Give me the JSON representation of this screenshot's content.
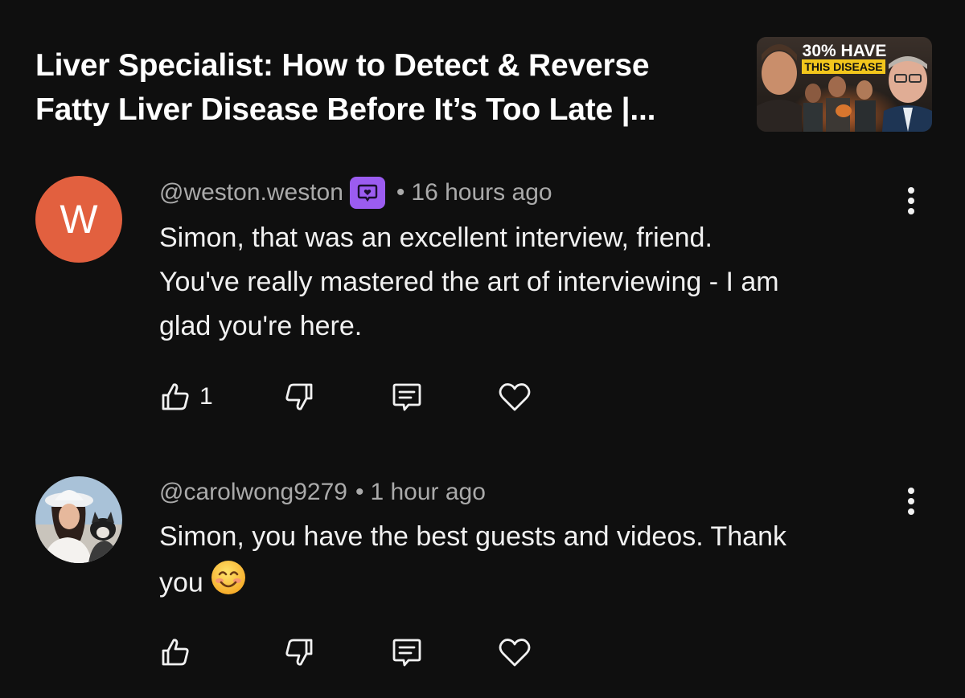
{
  "video": {
    "title_line1": "Liver Specialist: How to Detect & Reverse",
    "title_line2": "Fatty Liver Disease Before It’s Too Late |...",
    "thumbnail": {
      "text_line1": "30% HAVE",
      "text_line2": "THIS DISEASE"
    }
  },
  "comments": [
    {
      "avatar_letter": "W",
      "avatar_color": "#e2603f",
      "handle": "@weston.weston",
      "badge_icon": "member-chat-badge-icon",
      "separator": "•",
      "time": "16 hours ago",
      "text_lines": [
        "Simon, that was an excellent interview, friend.",
        "You've really mastered the art of interviewing - I am",
        "glad you're here."
      ],
      "likes": "1"
    },
    {
      "avatar_icon": "profile-photo",
      "handle": "@carolwong9279",
      "separator": "•",
      "time": "1 hour ago",
      "text_lines": [
        "Simon, you have the best guests and videos. Thank",
        "you"
      ],
      "emoji": "smiling-face-icon",
      "likes": ""
    }
  ],
  "icons": {
    "like": "thumbs-up-icon",
    "dislike": "thumbs-down-icon",
    "reply": "reply-comment-icon",
    "heart": "heart-icon",
    "more": "more-vertical-icon"
  },
  "colors": {
    "background": "#0f0f0f",
    "text": "#f1f1f1",
    "secondary_text": "#aaaaaa",
    "badge": "#9b5cf0"
  }
}
